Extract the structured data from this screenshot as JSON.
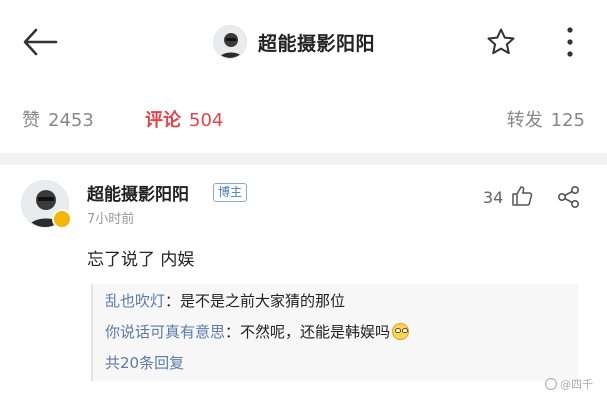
{
  "header": {
    "title": "超能摄影阳阳",
    "icons": {
      "back": "back-arrow-icon",
      "star": "star-icon",
      "more": "more-vertical-icon"
    }
  },
  "stats": {
    "likes_label": "赞",
    "likes_count": "2453",
    "comments_label": "评论",
    "comments_count": "504",
    "reposts_label": "转发",
    "reposts_count": "125"
  },
  "comment": {
    "author": "超能摄影阳阳",
    "badge": "博主",
    "time": "7小时前",
    "like_count": "34",
    "text": "忘了说了 内娱",
    "replies": [
      {
        "author": "乱也吹灯",
        "separator": "：",
        "text": "是不是之前大家猜的那位"
      },
      {
        "author": "你说话可真有意思",
        "separator": "：",
        "text": "不然呢，还能是韩娱吗",
        "emoji": "smiley-face-icon"
      }
    ],
    "more_replies": "共20条回复"
  },
  "watermark": {
    "text": "@四千"
  },
  "colors": {
    "accent_red": "#e0454b",
    "link_blue": "#5b7ba8",
    "badge_blue": "#4a7bb8",
    "verified_gold": "#f5b400",
    "divider_gray": "#f2f2f2"
  }
}
